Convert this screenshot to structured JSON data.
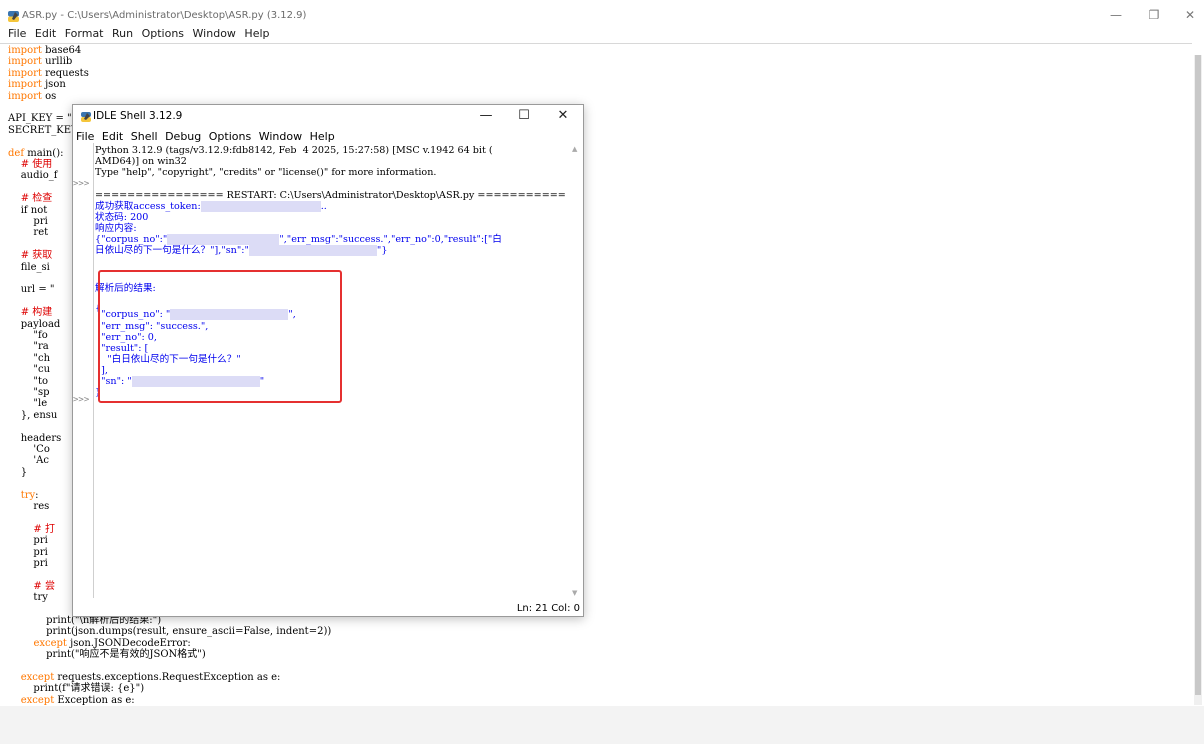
{
  "editor": {
    "title": "ASR.py - C:\\Users\\Administrator\\Desktop\\ASR.py (3.12.9)",
    "menu": [
      "File",
      "Edit",
      "Format",
      "Run",
      "Options",
      "Window",
      "Help"
    ],
    "window_controls": {
      "minimize": "—",
      "restore": "❐",
      "close": "✕"
    },
    "code_lines": [
      {
        "kw": "import",
        "rest": " base64"
      },
      {
        "kw": "import",
        "rest": " urllib"
      },
      {
        "kw": "import",
        "rest": " requests"
      },
      {
        "kw": "import",
        "rest": " json"
      },
      {
        "kw": "import",
        "rest": " os"
      },
      {
        "kw": "",
        "rest": ""
      },
      {
        "kw": "",
        "rest": "API_KEY = \""
      },
      {
        "kw": "",
        "rest": "SECRET_KEY ="
      },
      {
        "kw": "",
        "rest": ""
      },
      {
        "kw": "def",
        "rest": " main():"
      },
      {
        "kw": "",
        "rest": "    # 使用"
      },
      {
        "kw": "",
        "rest": "    audio_f"
      },
      {
        "kw": "",
        "rest": ""
      },
      {
        "kw": "",
        "rest": "    # 检查"
      },
      {
        "kw": "",
        "rest": "    if not"
      },
      {
        "kw": "",
        "rest": "        pri"
      },
      {
        "kw": "",
        "rest": "        ret"
      },
      {
        "kw": "",
        "rest": ""
      },
      {
        "kw": "",
        "rest": "    # 获取"
      },
      {
        "kw": "",
        "rest": "    file_si"
      },
      {
        "kw": "",
        "rest": ""
      },
      {
        "kw": "",
        "rest": "    url = \""
      },
      {
        "kw": "",
        "rest": ""
      },
      {
        "kw": "",
        "rest": "    # 构建"
      },
      {
        "kw": "",
        "rest": "    payload"
      },
      {
        "kw": "",
        "rest": "        \"fo"
      },
      {
        "kw": "",
        "rest": "        \"ra"
      },
      {
        "kw": "",
        "rest": "        \"ch"
      },
      {
        "kw": "",
        "rest": "        \"cu"
      },
      {
        "kw": "",
        "rest": "        \"to"
      },
      {
        "kw": "",
        "rest": "        \"sp"
      },
      {
        "kw": "",
        "rest": "        \"le"
      },
      {
        "kw": "",
        "rest": "    }, ensu"
      },
      {
        "kw": "",
        "rest": ""
      },
      {
        "kw": "",
        "rest": "    headers"
      },
      {
        "kw": "",
        "rest": "        'Co"
      },
      {
        "kw": "",
        "rest": "        'Ac"
      },
      {
        "kw": "",
        "rest": "    }"
      },
      {
        "kw": "",
        "rest": ""
      },
      {
        "kw": "    try",
        "rest": ":"
      },
      {
        "kw": "",
        "rest": "        res"
      },
      {
        "kw": "",
        "rest": ""
      },
      {
        "kw": "",
        "rest": "        # 打"
      },
      {
        "kw": "",
        "rest": "        pri"
      },
      {
        "kw": "",
        "rest": "        pri"
      },
      {
        "kw": "",
        "rest": "        pri"
      },
      {
        "kw": "",
        "rest": ""
      },
      {
        "kw": "",
        "rest": "        # 尝"
      },
      {
        "kw": "",
        "rest": "        try"
      },
      {
        "kw": "",
        "rest": ""
      },
      {
        "kw": "",
        "rest": "            print(\"\\n解析后的结果:\")"
      },
      {
        "kw": "",
        "rest": "            print(json.dumps(result, ensure_ascii=False, indent=2))"
      },
      {
        "kw": "        except",
        "rest": " json.JSONDecodeError:"
      },
      {
        "kw": "",
        "rest": "            print(\"响应不是有效的JSON格式\")"
      },
      {
        "kw": "",
        "rest": ""
      },
      {
        "kw": "    except",
        "rest": " requests.exceptions.RequestException as e:"
      },
      {
        "kw": "",
        "rest": "        print(f\"请求错误: {e}\")"
      },
      {
        "kw": "    except",
        "rest": " Exception as e:"
      }
    ]
  },
  "shell": {
    "title": "IDLE Shell 3.12.9",
    "menu": [
      "File",
      "Edit",
      "Shell",
      "Debug",
      "Options",
      "Window",
      "Help"
    ],
    "window_controls": {
      "minimize": "—",
      "maximize": "☐",
      "close": "✕"
    },
    "prompt": ">>>",
    "banner": [
      "Python 3.12.9 (tags/v3.12.9:fdb8142, Feb  4 2025, 15:27:58) [MSC v.1942 64 bit (",
      "AMD64)] on win32",
      "Type \"help\", \"copyright\", \"credits\" or \"license()\" for more information."
    ],
    "restart_line": "================ RESTART: C:\\Users\\Administrator\\Desktop\\ASR.py ================",
    "output": {
      "token_label": "成功获取access_token:",
      "token_suffix": "..",
      "status_code": "状态码: 200",
      "response_label": "响应内容:",
      "raw_json_1a": "{\"corpus_no\":\"",
      "raw_json_1b": "\",\"err_msg\":\"success.\",\"err_no\":0,\"result\":[\"白",
      "raw_json_2a": "日依山尽的下一句是什么？\"],\"sn\":\"",
      "raw_json_2b": "\"}",
      "parsed_label": "解析后的结果:",
      "parsed_lines": [
        "{",
        "  \"corpus_no\": \"",
        "  \"err_msg\": \"success.\",",
        "  \"err_no\": 0,",
        "  \"result\": [",
        "    \"白日依山尽的下一句是什么？\"",
        "  ],",
        "  \"sn\": \"",
        "}"
      ]
    },
    "status": "Ln: 21  Col: 0"
  },
  "colors": {
    "keyword": "#ff7700",
    "string": "#00aa00",
    "comment": "#dd0000",
    "output_blue": "#0000ee",
    "highlight_box": "#e53030"
  }
}
